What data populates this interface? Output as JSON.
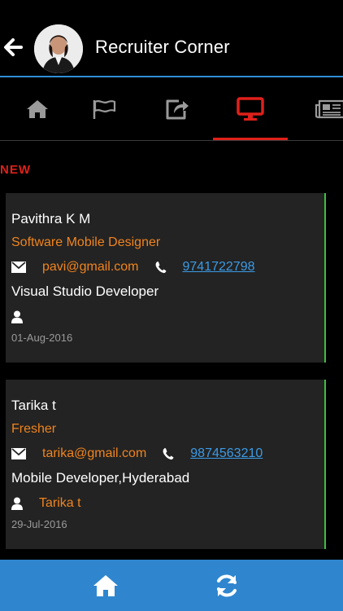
{
  "header": {
    "title": "Recruiter Corner"
  },
  "tabs": [
    {
      "icon": "home-icon",
      "active": false
    },
    {
      "icon": "flag-icon",
      "active": false
    },
    {
      "icon": "share-icon",
      "active": false
    },
    {
      "icon": "monitor-icon",
      "active": true
    },
    {
      "icon": "newspaper-icon",
      "active": false
    }
  ],
  "section": {
    "label": "NEW"
  },
  "candidates": [
    {
      "name": "Pavithra K M",
      "role": "Software Mobile Designer",
      "email": "pavi@gmail.com",
      "phone": "9741722798",
      "description": "Visual Studio Developer",
      "posted_by": "",
      "date": "01-Aug-2016"
    },
    {
      "name": "Tarika t",
      "role": "Fresher",
      "email": "tarika@gmail.com",
      "phone": "9874563210",
      "description": "Mobile Developer,Hyderabad",
      "posted_by": "Tarika t",
      "date": "29-Jul-2016"
    }
  ],
  "colors": {
    "accent_red": "#e0201a",
    "orange": "#f0841e",
    "link_blue": "#3b9be6",
    "bar_blue": "#2f86cf",
    "card_border_green": "#3fbf3f"
  }
}
